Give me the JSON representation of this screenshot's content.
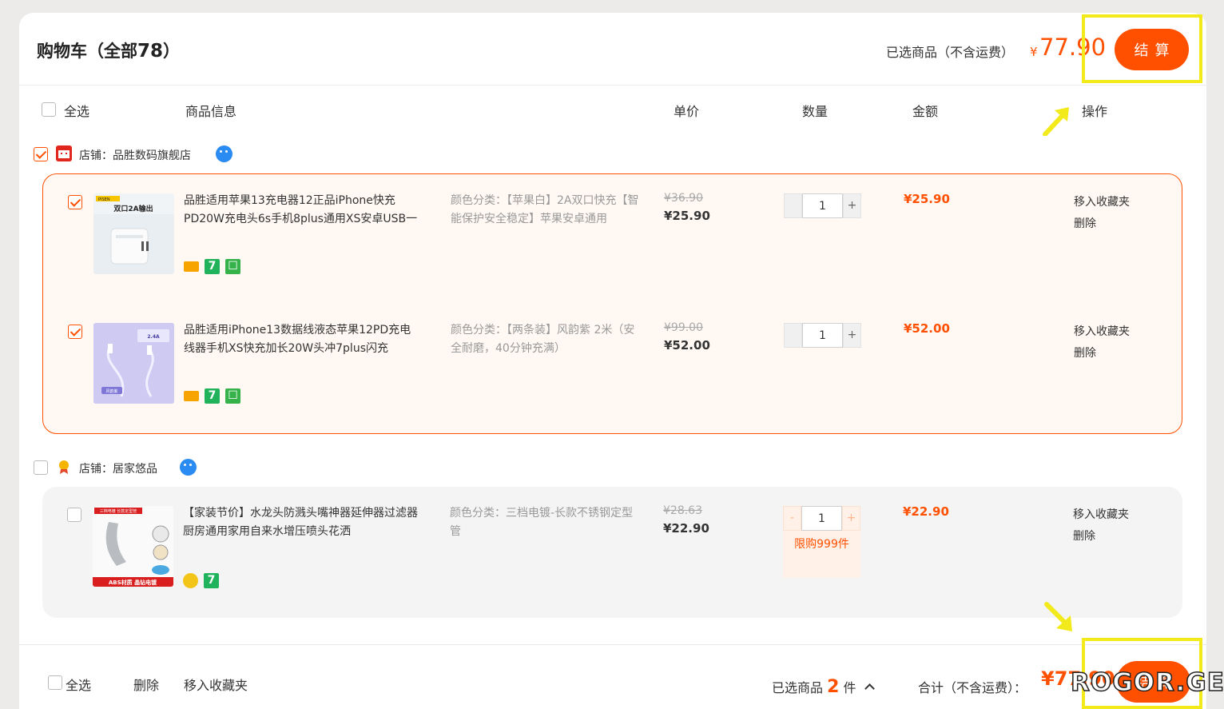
{
  "header": {
    "title": "购物车（全部",
    "count": "78",
    "title_end": "）",
    "selected_label": "已选商品（不含运费）",
    "currency": "¥",
    "selected_total": "77.90",
    "checkout_label": "结算"
  },
  "columns": {
    "select_all": "全选",
    "info": "商品信息",
    "unit_price": "单价",
    "quantity": "数量",
    "amount": "金额",
    "operation": "操作"
  },
  "shops": [
    {
      "name": "店铺：品胜数码旗舰店",
      "checked": true,
      "items": [
        {
          "checked": true,
          "title": "品胜适用苹果13充电器12正品iPhone快充PD20W充电头6s手机8plus通用XS安卓USB一",
          "sku": "颜色分类：【苹果白】2A双口快充【智能保护安全稳定】苹果安卓通用",
          "original_price": "¥36.90",
          "price": "¥25.90",
          "quantity": "1",
          "amount": "¥25.90",
          "thumb_text": "双口2A输出",
          "thumb_brand": "PISEN"
        },
        {
          "checked": true,
          "title": "品胜适用iPhone13数据线液态苹果12PD充电线器手机XS快充加长20W头冲7plus闪充",
          "sku": "颜色分类：【两条装】风韵紫 2米（安全耐磨，40分钟充满）",
          "original_price": "¥99.00",
          "price": "¥52.00",
          "quantity": "1",
          "amount": "¥52.00",
          "thumb_text": "2.4A",
          "thumb_brand": "风韵紫"
        }
      ]
    },
    {
      "name": "店铺：居家悠品",
      "checked": false,
      "items": [
        {
          "checked": false,
          "title": "【家装节价】水龙头防溅头嘴神器延伸器过滤器厨房通用家用自来水增压喷头花洒",
          "sku": "颜色分类：三档电镀-长款不锈钢定型管",
          "original_price": "¥28.63",
          "price": "¥22.90",
          "quantity": "1",
          "amount": "¥22.90",
          "limit": "限购999件",
          "thumb_text": "ABS材质 晶钻电镀",
          "thumb_brand": "三档电镀 长款定型管"
        }
      ]
    }
  ],
  "item_ops": {
    "move_to_favorites": "移入收藏夹",
    "delete": "删除"
  },
  "qty_controls": {
    "minus": "-",
    "plus": "+"
  },
  "footer": {
    "select_all": "全选",
    "delete": "删除",
    "move_to_favorites": "移入收藏夹",
    "selected_prefix": "已选商品",
    "selected_count": "2",
    "selected_suffix": "件",
    "total_label": "合计（不含运费）：",
    "total_visible": "¥77.90"
  },
  "watermark": "ROGOR.GE",
  "colors": {
    "accent": "#ff5000",
    "highlight": "#f3ea1c",
    "selected_bg": "#fff8f3"
  }
}
